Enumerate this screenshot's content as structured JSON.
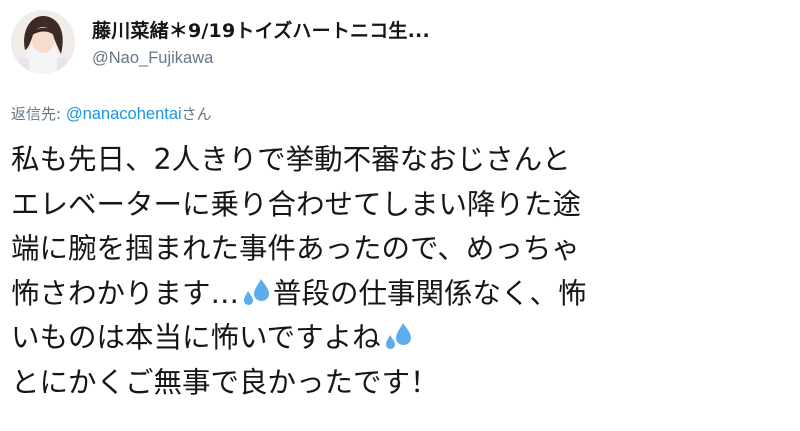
{
  "tweet": {
    "author": {
      "display_name": "藤川菜緒＊9/19トイズハートニコ生...",
      "handle": "@Nao_Fujikawa",
      "avatar_icon": "profile-photo"
    },
    "reply": {
      "prefix": "返信先: ",
      "mention": "@nanacohentai",
      "suffix": "さん"
    },
    "body": {
      "line1": "私も先日、2人きりで挙動不審なおじさんと",
      "line2": "エレベーターに乗り合わせてしまい降りた途",
      "line3": "端に腕を掴まれた事件あったので、めっちゃ",
      "line4a": "怖さわかります…",
      "line4b": "普段の仕事関係なく、怖",
      "line5": "いものは本当に怖いですよね",
      "line6": "とにかくご無事で良かったです！",
      "emoji": "sweat-droplets-icon"
    },
    "colors": {
      "text": "#14171a",
      "secondary": "#657786",
      "link": "#1b95e0",
      "emoji": "#5dadec"
    }
  }
}
